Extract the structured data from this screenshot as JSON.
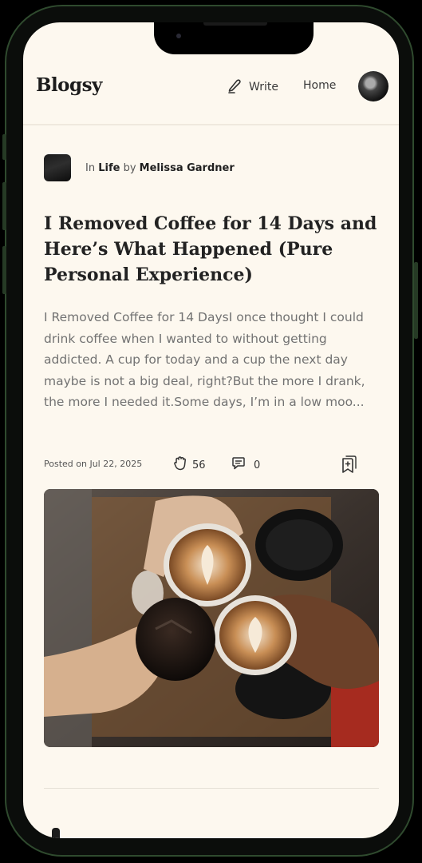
{
  "header": {
    "brand": "Blogsy",
    "write_label": "Write",
    "home_label": "Home"
  },
  "post": {
    "in_label": "In",
    "category": "Life",
    "by_label": "by",
    "author": "Melissa Gardner",
    "title": "I Removed Coffee for 14 Days and Here’s What Happened (Pure Personal Experience)",
    "excerpt": "I Removed Coffee for 14 DaysI once thought I could drink coffee when I wanted to without getting addicted. A cup for today and a cup the next day maybe is not a big deal, right?But the more I drank, the more I needed it.Some days, I’m in a low moo...",
    "posted": "Posted on Jul 22, 2025",
    "claps": "56",
    "comments": "0"
  },
  "colors": {
    "background": "#fdf8ef",
    "text": "#222222",
    "muted": "#727272",
    "frame": "#2f4a2e"
  },
  "icons": {
    "write": "pen-icon",
    "claps": "clap-icon",
    "comments": "comment-icon",
    "bookmark": "bookmark-icon"
  }
}
